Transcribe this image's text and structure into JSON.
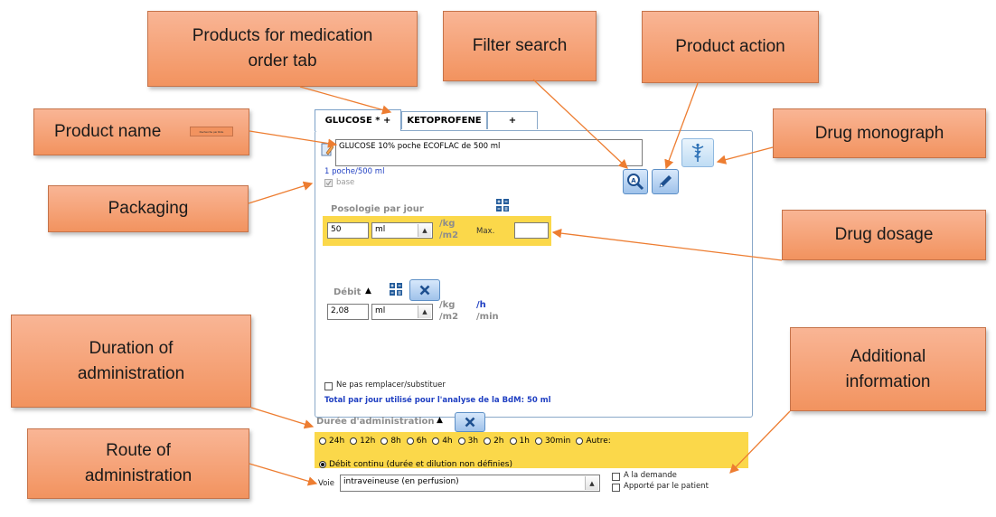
{
  "callouts": {
    "products_tab": "Products for medication order tab",
    "filter_search": "Filter search",
    "product_action": "Product action",
    "product_name": "Product name",
    "product_name_mini": "Recherche par Rôle",
    "drug_monograph": "Drug monograph",
    "packaging": "Packaging",
    "drug_dosage": "Drug dosage",
    "duration": "Duration of administration",
    "additional_info": "Additional information",
    "route": "Route of administration"
  },
  "app": {
    "tabs": [
      {
        "label": "GLUCOSE * +",
        "active": true
      },
      {
        "label": "KETOPROFENE",
        "active": false
      },
      {
        "label": "+",
        "active": false
      }
    ],
    "product_name_value": "GLUCOSE 10% poche ECOFLAC de 500 ml",
    "packaging_text": "1 poche/500 ml",
    "base_label": "base",
    "posologie": {
      "title": "Posologie par jour",
      "value": "50",
      "unit": "ml",
      "per_kg": "/kg",
      "per_m2": "/m2",
      "max_label": "Max.",
      "max_value": ""
    },
    "debit": {
      "title": "Débit",
      "value": "2,08",
      "unit": "ml",
      "per_kg": "/kg",
      "per_m2": "/m2",
      "per_h": "/h",
      "per_min": "/min"
    },
    "ne_pas_remplacer": "Ne pas remplacer/substituer",
    "total_text": "Total par jour utilisé pour l'analyse de la BdM: 50 ml",
    "duree": {
      "title": "Durée d'administration",
      "options": [
        "24h",
        "12h",
        "8h",
        "6h",
        "4h",
        "3h",
        "2h",
        "1h",
        "30min",
        "Autre:"
      ],
      "continu": "Débit continu (durée et dilution non définies)"
    },
    "voie": {
      "label": "Voie",
      "value": "intraveineuse (en perfusion)"
    },
    "a_la_demande": "A la demande",
    "apporte_patient": "Apporté par le patient"
  },
  "colors": {
    "callout_fill": "#f2935f",
    "highlight_yellow": "#fbd84a",
    "arrow": "#ed7d31",
    "link_blue": "#1f3fc2"
  }
}
